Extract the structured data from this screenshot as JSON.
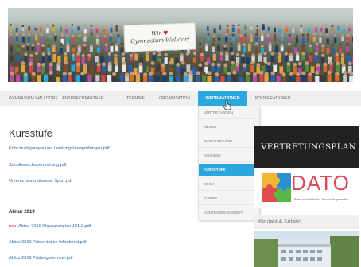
{
  "header": {
    "banner_line1": "Wir",
    "banner_line2": "Gymnasium Walldorf"
  },
  "nav": {
    "items": [
      {
        "label": "GYMNASIUM WALLDORF"
      },
      {
        "label": "ANSPRECHPARTNER"
      },
      {
        "label": "TERMINE"
      },
      {
        "label": "ORGANISATION"
      },
      {
        "label": "INFORMATIONEN"
      },
      {
        "label": "KOOPERATIONEN"
      }
    ],
    "active_color": "#2aa7de"
  },
  "dropdown": {
    "items": [
      {
        "label": "VERTRETUNGEN"
      },
      {
        "label": "MENSA"
      },
      {
        "label": "BUSFAHRPLÄNE"
      },
      {
        "label": "SCHÜLER"
      },
      {
        "label": "KURSSTUFE"
      },
      {
        "label": "BOGY"
      },
      {
        "label": "ELTERN"
      },
      {
        "label": "GANZTAGESANGEBOT"
      }
    ],
    "active_label": "KURSSTUFE"
  },
  "main": {
    "title": "Kursstufe",
    "links": [
      {
        "text": "Entschuldigungen und Leistungsüberprüfungen.pdf"
      },
      {
        "text": "Schulbesuchsverordnung.pdf"
      },
      {
        "text": "Unterrichtsversäumnis Sport.pdf"
      }
    ],
    "section_title": "Abitur 2019",
    "abitur_links": [
      {
        "prefix": "neu:",
        "text": " Abitur 2019 Klausurenplan JS1.2.pdf"
      },
      {
        "prefix": "",
        "text": "Abitur 2019 Präsentation Infoabend.pdf"
      },
      {
        "prefix": "",
        "text": "Abitur 2019 Prüfungstermine.pdf"
      }
    ]
  },
  "sidebar": {
    "vertretungsplan_label": "VERTRETUNGSPLAN",
    "dato_label": "DATO",
    "dato_sub": "Dokumente Aktueller Termine Organisation",
    "kontakt_label": "Kontakt & Anfahrt"
  }
}
